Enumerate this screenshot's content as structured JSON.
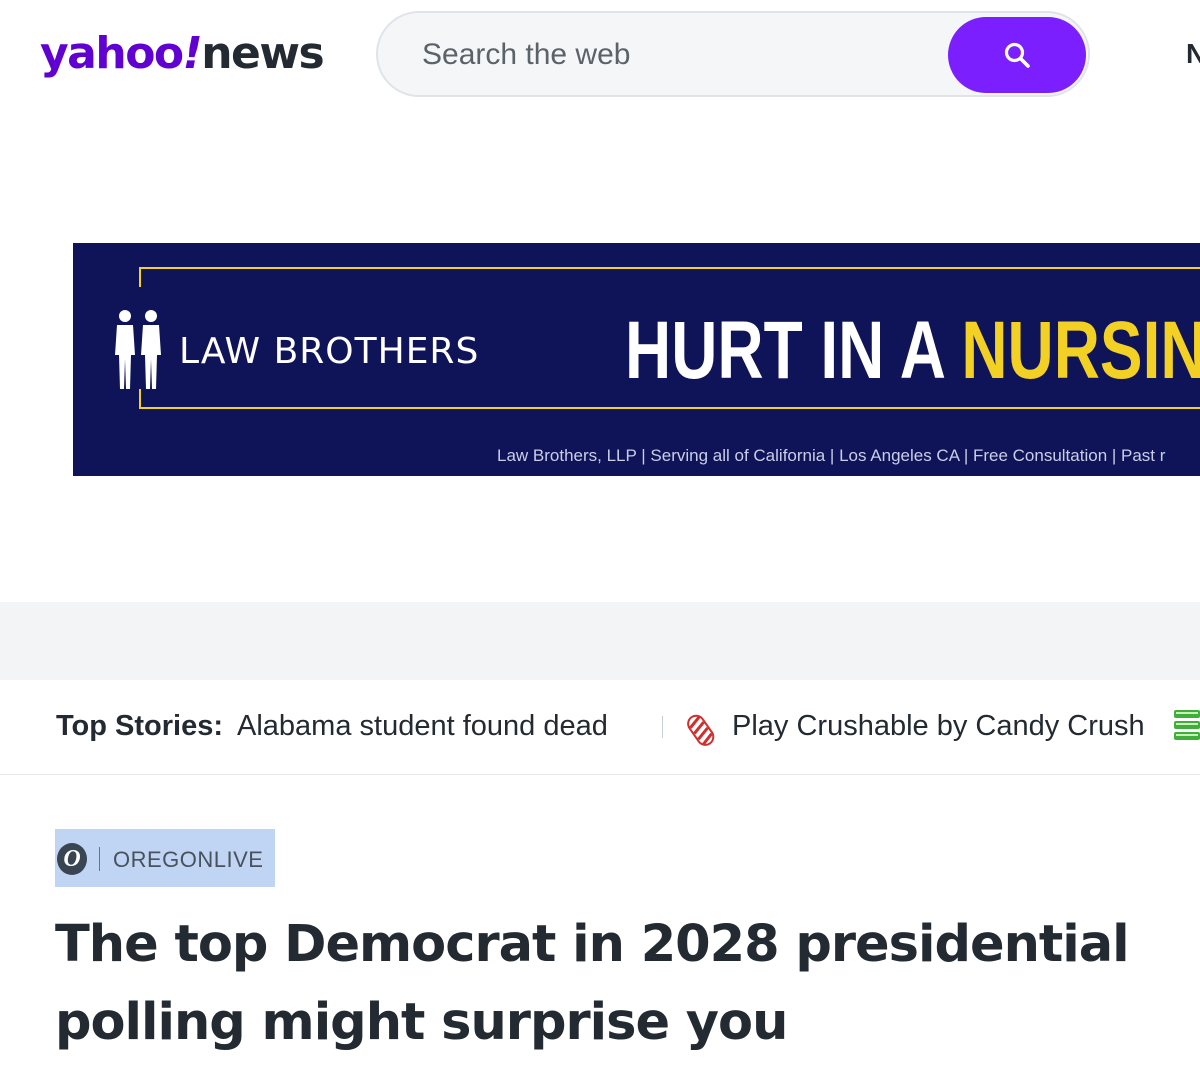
{
  "header": {
    "logo": {
      "brand": "yahoo",
      "bang": "!",
      "section": "news"
    },
    "search": {
      "placeholder": "Search the web",
      "icon": "search-icon"
    },
    "clipped_nav_label": "N"
  },
  "ad": {
    "brand": "LAW BROTHERS",
    "headline_white": "HURT IN A ",
    "headline_yellow": "NURSING H",
    "fine_print": "Law Brothers, LLP | Serving all of California | Los Angeles CA | Free Consultation | Past r",
    "colors": {
      "background": "#0f1459",
      "accent": "#f2d024"
    }
  },
  "top_stories": {
    "label": "Top Stories:",
    "items": [
      {
        "text": "Alabama student found dead"
      },
      {
        "text": "Play Crushable by Candy Crush",
        "icon": "candy-icon"
      }
    ]
  },
  "article": {
    "source": "OREGONLIVE",
    "source_logo_letter": "O",
    "title": "The top Democrat in 2028 presidential polling might surprise you"
  },
  "colors": {
    "brand_purple": "#6001d2",
    "search_button": "#7b1fff",
    "text": "#232a31",
    "selection": "#bfd5f3"
  }
}
